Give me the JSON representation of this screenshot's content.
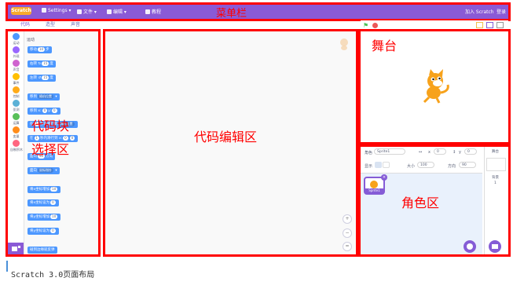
{
  "menubar": {
    "logo": "Scratch",
    "settings": "Settings",
    "file": "文件",
    "edit": "编辑",
    "tutorials": "教程",
    "join": "加入 Scratch",
    "signin": "登录",
    "annotation": "菜单栏"
  },
  "tabs": {
    "code": "代码",
    "costumes": "造型",
    "sounds": "声音"
  },
  "categories": [
    {
      "label": "运动",
      "color": "#4c97ff"
    },
    {
      "label": "外观",
      "color": "#9966ff"
    },
    {
      "label": "声音",
      "color": "#cf63cf"
    },
    {
      "label": "事件",
      "color": "#ffbf00"
    },
    {
      "label": "控制",
      "color": "#ffab19"
    },
    {
      "label": "侦测",
      "color": "#5cb1d6"
    },
    {
      "label": "运算",
      "color": "#59c059"
    },
    {
      "label": "变量",
      "color": "#ff8c1a"
    },
    {
      "label": "自制积木",
      "color": "#ff6680"
    }
  ],
  "palette": {
    "heading": "运动",
    "blocks": {
      "move": "移动",
      "move_val": "10",
      "move_unit": "步",
      "turn_r": "右转",
      "turn_r_val": "15",
      "deg": "度",
      "turn_l": "左转",
      "turn_l_val": "15",
      "goto": "移到",
      "goto_opt": "随机位置",
      "gotoxy": "移到 x:",
      "x_val": "0",
      "y_lbl": "y:",
      "y_val": "0",
      "glide": "在",
      "glide_val": "1",
      "glide_txt": "秒内滑行到",
      "glide_opt": "随机位置",
      "glide2": "在",
      "glide2_val": "1",
      "glide2_txt": "秒内滑行到 x:",
      "glide2_x": "0",
      "glide2_y": "0",
      "point": "面向",
      "point_val": "90",
      "point_unit": "方向",
      "pointto": "面向",
      "pointto_opt": "鼠标指针",
      "changex": "将x坐标增加",
      "changex_val": "10",
      "setx": "将x坐标设为",
      "setx_val": "0",
      "changey": "将y坐标增加",
      "changey_val": "10",
      "sety": "将y坐标设为",
      "sety_val": "0",
      "edge": "碰到边缘就反弹"
    },
    "annotation_line1": "代码块",
    "annotation_line2": "选择区"
  },
  "codearea": {
    "annotation": "代码编辑区",
    "zoom_in": "+",
    "zoom_out": "−",
    "reset": "="
  },
  "stage": {
    "annotation": "舞台"
  },
  "sprite": {
    "label_sprite": "角色",
    "name": "Sprite1",
    "x_label": "x",
    "x_val": "0",
    "y_label": "y",
    "y_val": "0",
    "show_label": "显示",
    "size_label": "大小",
    "size_val": "100",
    "dir_label": "方向",
    "dir_val": "90",
    "thumb_name": "Sprite1",
    "annotation": "角色区",
    "stage_label": "舞台",
    "backdrops_label": "背景",
    "backdrops_count": "1"
  },
  "caption": "Scratch 3.0页面布局"
}
